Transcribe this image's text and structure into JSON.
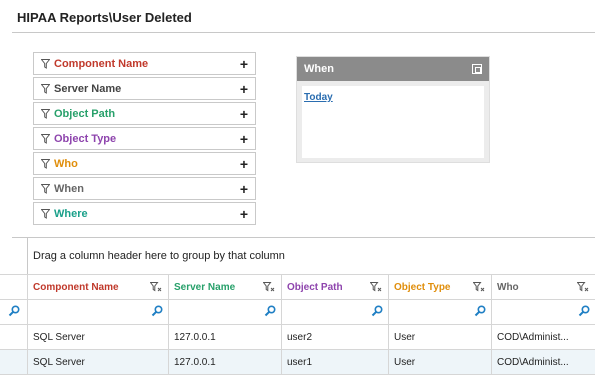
{
  "header": {
    "title": "HIPAA Reports\\User Deleted"
  },
  "filters": [
    {
      "label": "Component Name",
      "color": "#c0392b"
    },
    {
      "label": "Server Name",
      "color": "#444444"
    },
    {
      "label": "Object Path",
      "color": "#27a06a"
    },
    {
      "label": "Object Type",
      "color": "#8e44ad"
    },
    {
      "label": "Who",
      "color": "#e08e0b"
    },
    {
      "label": "When",
      "color": "#666666"
    },
    {
      "label": "Where",
      "color": "#1aa08a"
    }
  ],
  "filter_add_symbol": "+",
  "when_panel": {
    "title": "When",
    "link": "Today"
  },
  "grid": {
    "group_hint": "Drag a column header here to group by that column",
    "columns": [
      {
        "label": "Component Name",
        "color": "#c0392b"
      },
      {
        "label": "Server Name",
        "color": "#27a06a"
      },
      {
        "label": "Object Path",
        "color": "#8e44ad"
      },
      {
        "label": "Object Type",
        "color": "#e08e0b"
      },
      {
        "label": "Who",
        "color": "#666666"
      }
    ],
    "rows": [
      [
        "SQL Server",
        "127.0.0.1",
        "user2",
        "User",
        "COD\\Administ..."
      ],
      [
        "SQL Server",
        "127.0.0.1",
        "user1",
        "User",
        "COD\\Administ..."
      ]
    ]
  },
  "icons": {
    "filter": "funnel-icon",
    "search": "search-icon",
    "column_filter": "column-filter-icon",
    "maximize": "maximize-icon"
  }
}
